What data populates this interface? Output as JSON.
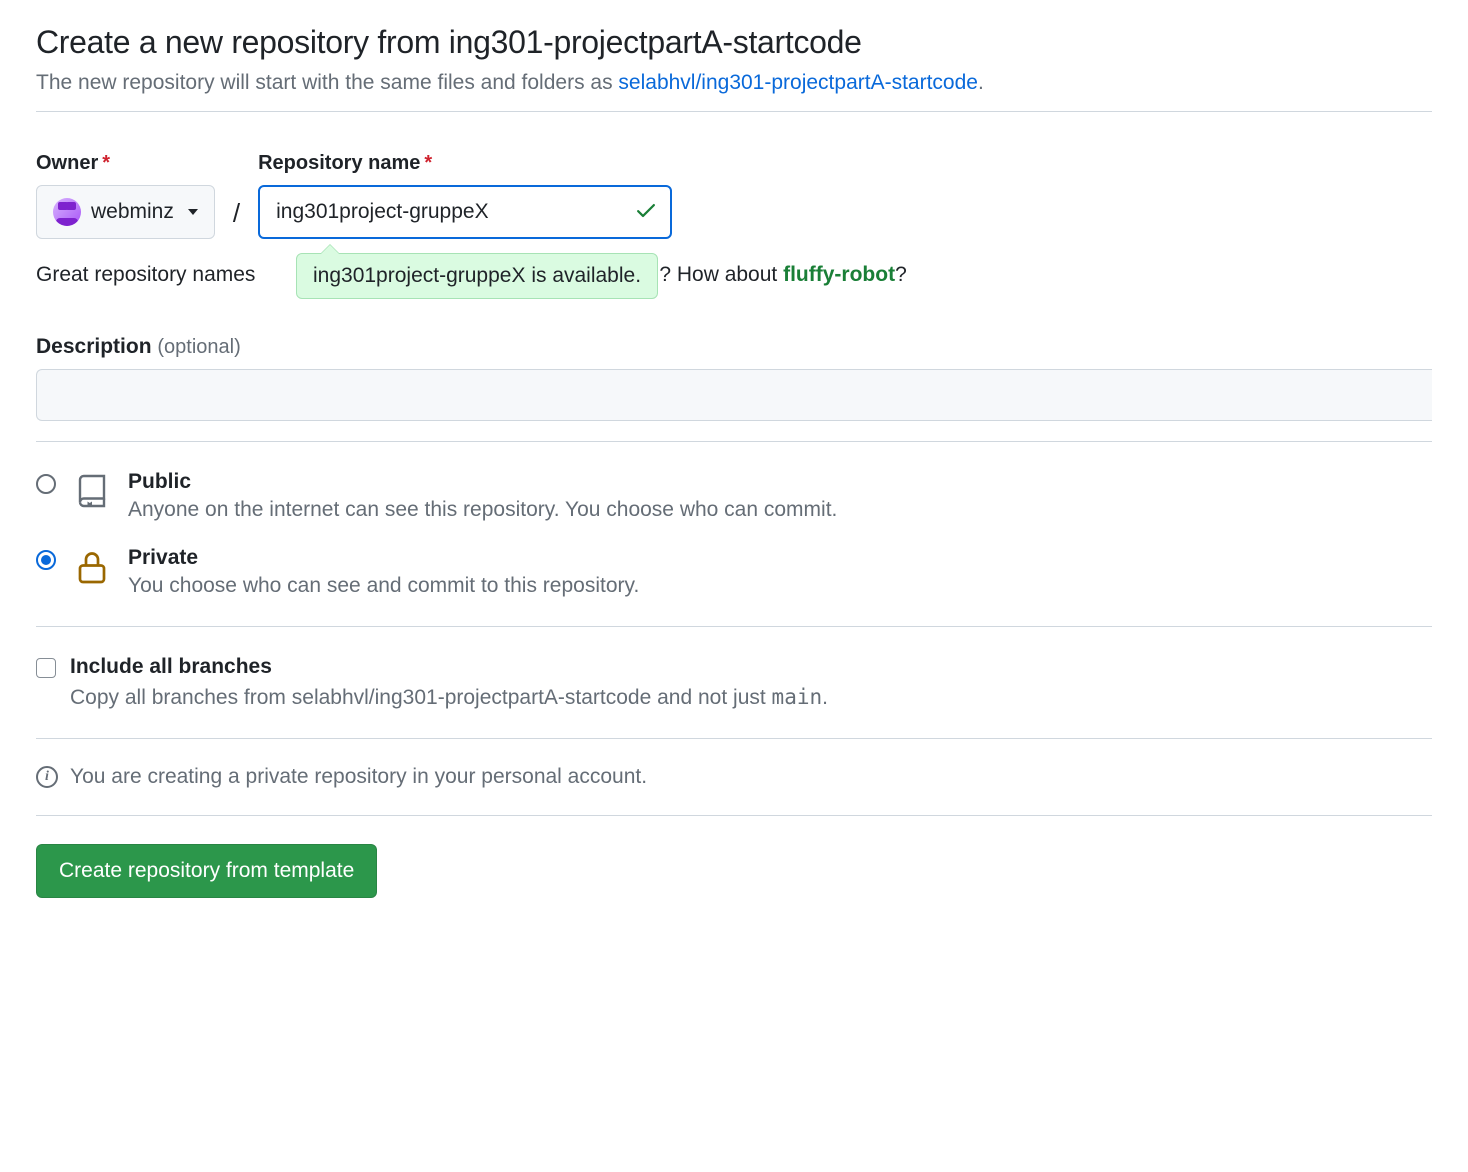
{
  "header": {
    "title": "Create a new repository from ing301-projectpartA-startcode",
    "subtitle_prefix": "The new repository will start with the same files and folders as ",
    "subtitle_link": "selabhvl/ing301-projectpartA-startcode",
    "subtitle_suffix": "."
  },
  "form": {
    "owner_label": "Owner",
    "owner_value": "webminz",
    "repo_label": "Repository name",
    "repo_value": "ing301project-gruppeX",
    "hint_prefix": "Great repository names",
    "hint_mid_hidden": "nspiration? How about ",
    "hint_suggestion": "fluffy-robot",
    "hint_suffix": "?",
    "availability_text": "ing301project-gruppeX is available.",
    "description_label": "Description",
    "description_optional": "(optional)",
    "description_value": ""
  },
  "visibility": {
    "public": {
      "title": "Public",
      "desc": "Anyone on the internet can see this repository. You choose who can commit."
    },
    "private": {
      "title": "Private",
      "desc": "You choose who can see and commit to this repository."
    },
    "selected": "private"
  },
  "branches": {
    "title": "Include all branches",
    "desc_prefix": "Copy all branches from selabhvl/ing301-projectpartA-startcode and not just ",
    "desc_mono": "main",
    "desc_suffix": ".",
    "checked": false
  },
  "info": {
    "text": "You are creating a private repository in your personal account."
  },
  "submit": {
    "label": "Create repository from template"
  }
}
